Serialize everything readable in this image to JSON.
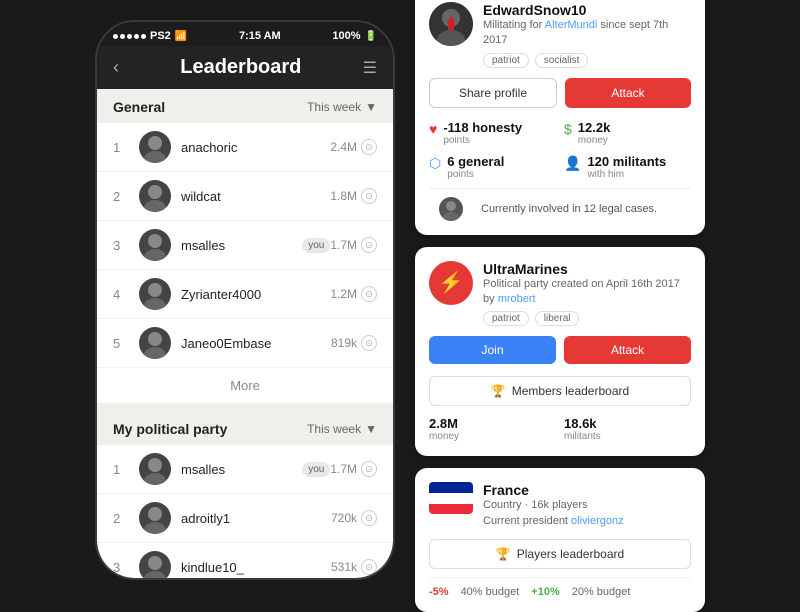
{
  "phone": {
    "statusBar": {
      "carrier": "PS2",
      "time": "7:15 AM",
      "battery": "100%"
    },
    "header": {
      "backLabel": "‹",
      "title": "Leaderboard",
      "filterIcon": "☰"
    },
    "generalSection": {
      "title": "General",
      "filter": "This week",
      "items": [
        {
          "rank": 1,
          "name": "anachoric",
          "score": "2.4M",
          "you": false
        },
        {
          "rank": 2,
          "name": "wildcat",
          "score": "1.8M",
          "you": false
        },
        {
          "rank": 3,
          "name": "msalles",
          "score": "1.7M",
          "you": true
        },
        {
          "rank": 4,
          "name": "Zyrianter4000",
          "score": "1.2M",
          "you": false
        },
        {
          "rank": 5,
          "name": "Janeo0Embase",
          "score": "819k",
          "you": false
        }
      ],
      "moreLabel": "More"
    },
    "partySection": {
      "title": "My political party",
      "filter": "This week",
      "items": [
        {
          "rank": 1,
          "name": "msalles",
          "score": "1.7M",
          "you": true
        },
        {
          "rank": 2,
          "name": "adroitly1",
          "score": "720k",
          "you": false
        },
        {
          "rank": 3,
          "name": "kindlue10_",
          "score": "531k",
          "you": false
        }
      ]
    }
  },
  "userCard": {
    "username": "EdwardSnow10",
    "subtitle": "Militating for AlterMundi since sept 7th 2017",
    "subtitleLink": "AlterMundi",
    "tags": [
      "patriot",
      "socialist"
    ],
    "shareLabel": "Share profile",
    "attackLabel": "Attack",
    "stats": [
      {
        "icon": "♥",
        "val": "-118 honesty",
        "lbl": "points",
        "color": "red"
      },
      {
        "icon": "$",
        "val": "12.2k",
        "lbl": "money",
        "color": "green"
      },
      {
        "icon": "⬡",
        "val": "6 general",
        "lbl": "points",
        "color": "blue"
      },
      {
        "icon": "👤",
        "val": "120 militants",
        "lbl": "with him",
        "color": "blue"
      }
    ],
    "legalText": "Currently involved in 12 legal cases."
  },
  "partyCard": {
    "name": "UltraMarines",
    "subtitle": "Political party created on April 16th 2017 by mrobert",
    "subtitleLink": "mrobert",
    "tags": [
      "patriot",
      "liberal"
    ],
    "joinLabel": "Join",
    "attackLabel": "Attack",
    "leaderboardLabel": "Members leaderboard",
    "stats": [
      {
        "val": "2.8M",
        "lbl": "money"
      },
      {
        "val": "18.6k",
        "lbl": "militants"
      }
    ]
  },
  "countryCard": {
    "name": "France",
    "subtitle": "Country · 16k players",
    "subtitleLink": "oliviergonz",
    "subtitleLinkLabel": "oliviergonz",
    "currentPresident": "Current president",
    "leaderboardLabel": "Players leaderboard",
    "budget": [
      {
        "val": "-5%",
        "lbl": "40% budget",
        "type": "neg"
      },
      {
        "val": "+10%",
        "lbl": "20% budget",
        "type": "pos"
      }
    ]
  }
}
